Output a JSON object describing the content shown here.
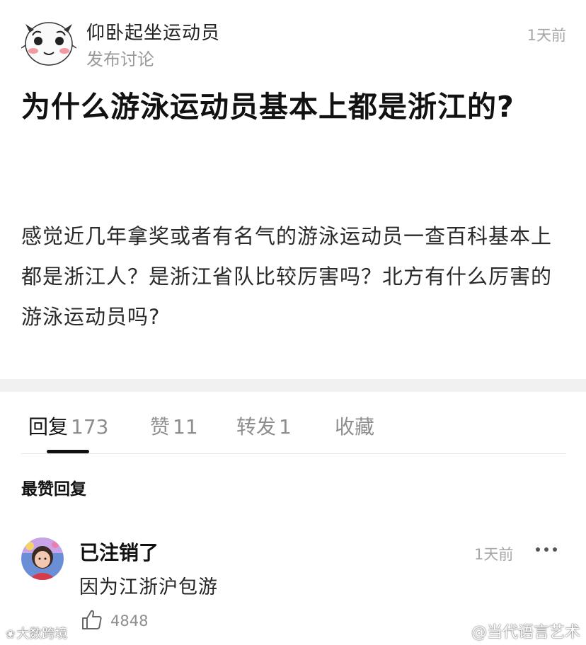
{
  "post": {
    "author": "仰卧起坐运动员",
    "subtitle": "发布讨论",
    "time": "1天前",
    "title": "为什么游泳运动员基本上都是浙江的?",
    "body": "感觉近几年拿奖或者有名气的游泳运动员一查百科基本上都是浙江人？是浙江省队比较厉害吗？北方有什么厉害的游泳运动员吗?"
  },
  "tabs": [
    {
      "label": "回复",
      "count": "173"
    },
    {
      "label": "赞",
      "count": "11"
    },
    {
      "label": "转发",
      "count": "1"
    },
    {
      "label": "收藏",
      "count": ""
    }
  ],
  "section_title": "最赞回复",
  "comments": [
    {
      "user": "已注销了",
      "time": "1天前",
      "text": "因为江浙沪包游",
      "likes": "4848"
    }
  ],
  "icons": {
    "author_avatar": "cartoon-face-icon",
    "more": "more-dots-icon",
    "like": "thumbs-up-icon",
    "weibo": "weibo-icon"
  },
  "watermarks": {
    "left": "大数跨境",
    "right": "@当代语言艺术"
  },
  "colors": {
    "text_primary": "#111111",
    "text_secondary": "#8e8e8e",
    "divider": "#f1f1f1"
  }
}
